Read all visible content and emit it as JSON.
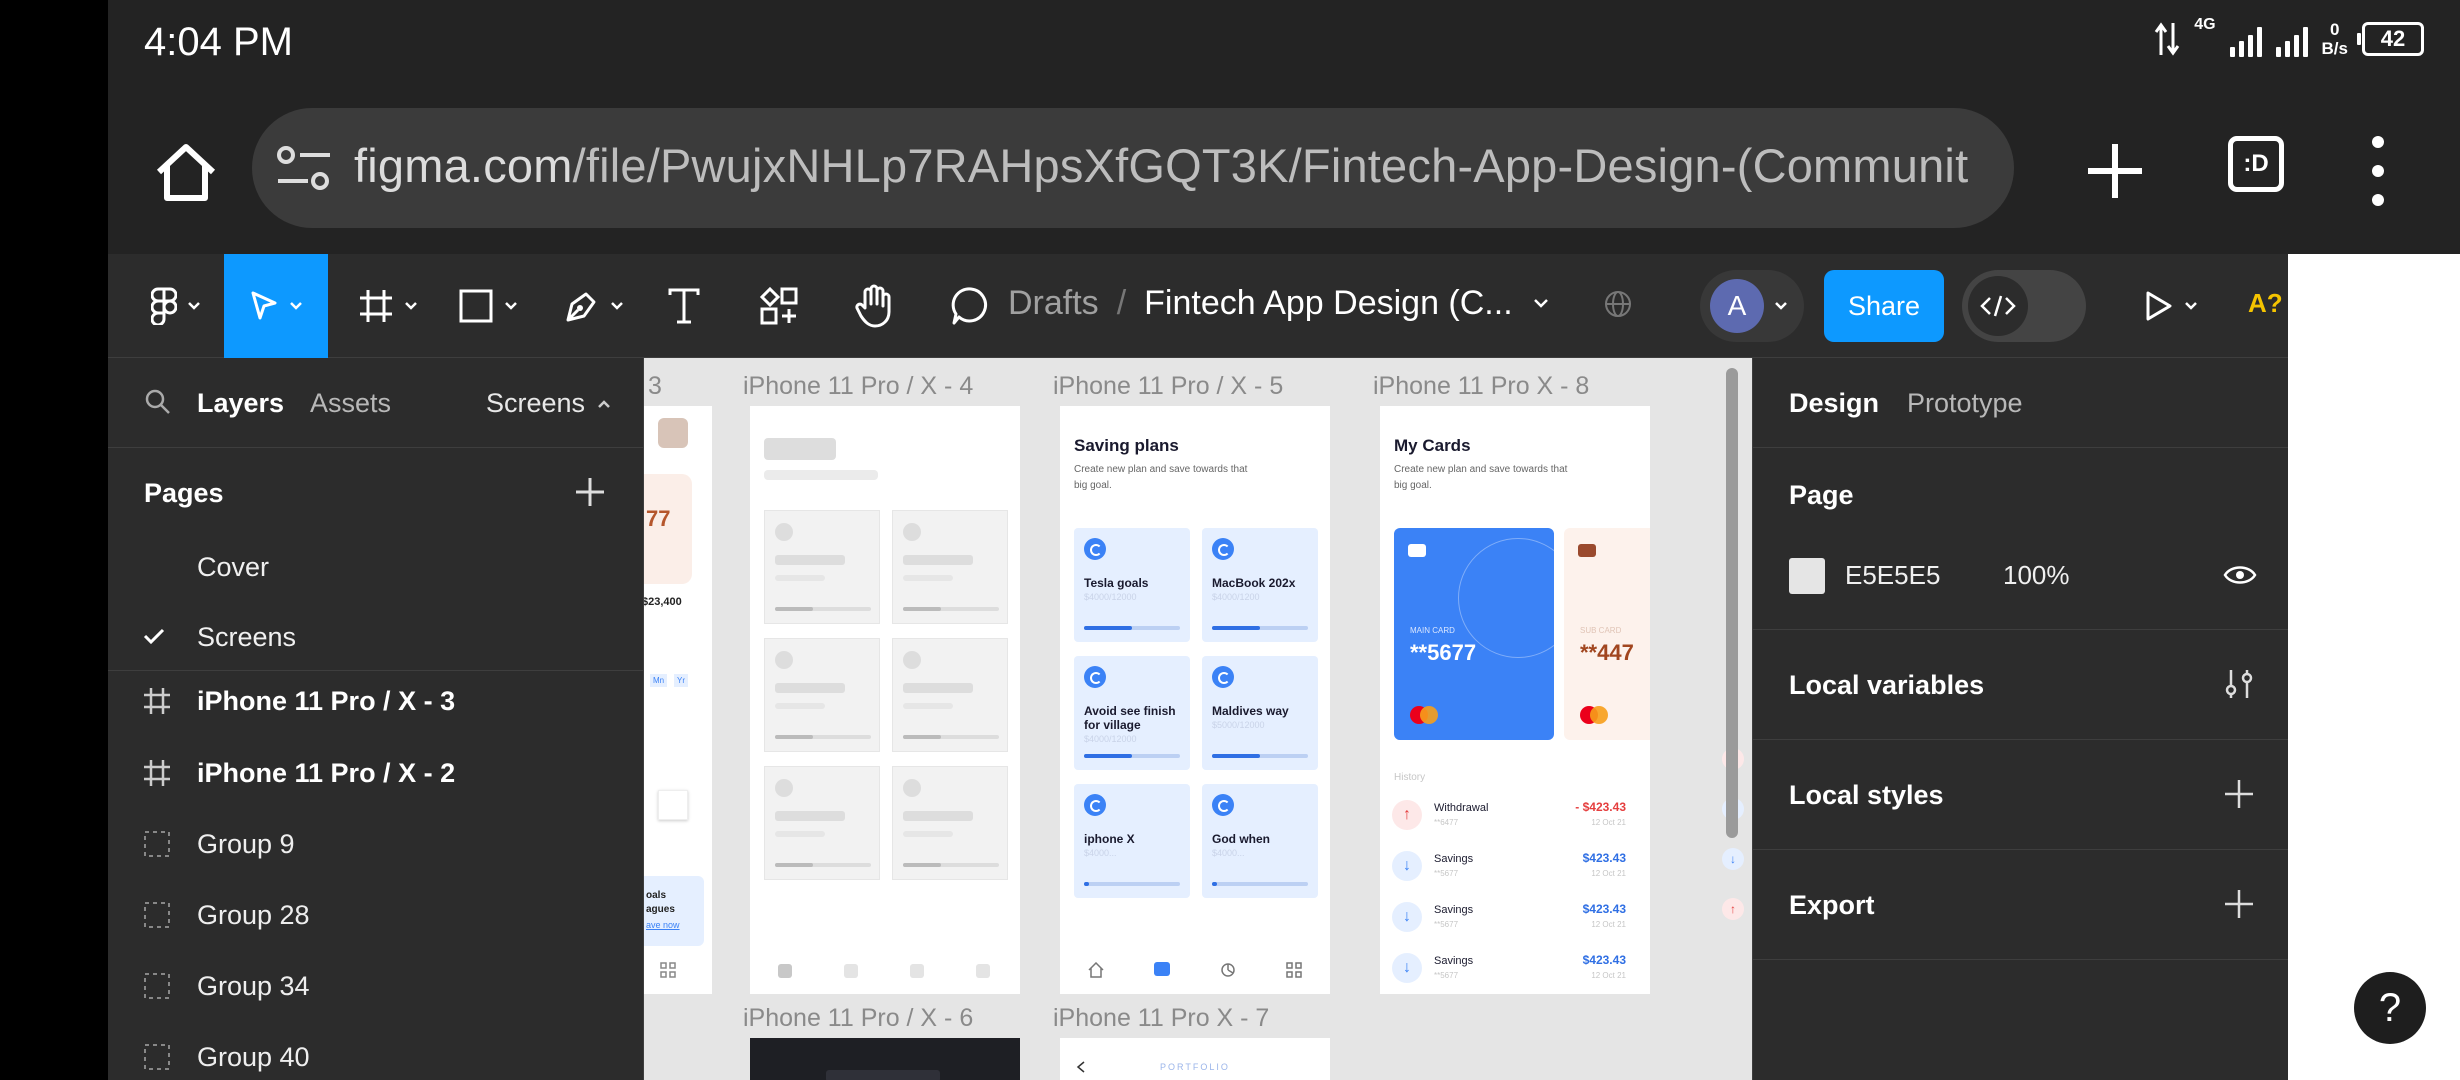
{
  "status_bar": {
    "time": "4:04 PM",
    "network_type": "4G",
    "data_speed_value": "0",
    "data_speed_unit": "B/s",
    "battery": "42"
  },
  "browser": {
    "url_host": "figma.com",
    "url_path": "/file/PwujxNHLp7RAHpsXfGQT3K/Fintech-App-Design-(Communit",
    "tabs_label": ":D"
  },
  "toolbar": {
    "breadcrumb_drafts": "Drafts",
    "breadcrumb_sep": "/",
    "file_name": "Fintech App Design (C...",
    "avatar_initial": "A",
    "share_label": "Share",
    "ai_label": "A?"
  },
  "left_panel": {
    "tabs": {
      "layers": "Layers",
      "assets": "Assets"
    },
    "current_page": "Screens",
    "pages_title": "Pages",
    "pages": [
      "Cover",
      "Screens"
    ],
    "layers": [
      {
        "label": "iPhone 11 Pro / X - 3",
        "type": "frame"
      },
      {
        "label": "iPhone 11 Pro / X - 2",
        "type": "frame"
      },
      {
        "label": "Group 9",
        "type": "group"
      },
      {
        "label": "Group 28",
        "type": "group"
      },
      {
        "label": "Group 34",
        "type": "group"
      },
      {
        "label": "Group 40",
        "type": "group"
      }
    ]
  },
  "canvas": {
    "background": "#E5E5E5",
    "frame_labels": {
      "x3": "3",
      "x4": "iPhone 11 Pro / X - 4",
      "x5": "iPhone 11 Pro / X - 5",
      "x8": "iPhone 11 Pro  X - 8",
      "x6": "iPhone 11 Pro / X - 6",
      "x7": "iPhone 11 Pro  X - 7"
    },
    "frame3": {
      "amount_partial": "77",
      "balance_partial": "$23,400",
      "chips": [
        "Mn",
        "Yr"
      ],
      "promo_l1": "oals",
      "promo_l2": "agues",
      "promo_link": "ave now"
    },
    "saving_plans": {
      "title": "Saving plans",
      "subtitle_l1": "Create new plan and save towards that",
      "subtitle_l2": "big goal.",
      "plans": [
        {
          "title": "Tesla goals",
          "sub": "$4000/12000",
          "progress": 0.5
        },
        {
          "title": "MacBook 202x",
          "sub": "$4000/1200",
          "progress": 0.5
        },
        {
          "title": "Avoid see finish for village",
          "sub": "$4000/12000",
          "progress": 0.5
        },
        {
          "title": "Maldives way",
          "sub": "$5000/12000",
          "progress": 0.5
        },
        {
          "title": "iphone X",
          "sub": "$4000...",
          "progress": 0.05
        },
        {
          "title": "God when",
          "sub": "$4000...",
          "progress": 0.05
        }
      ]
    },
    "my_cards": {
      "title": "My Cards",
      "subtitle_l1": "Create new plan and save towards that",
      "subtitle_l2": "big goal.",
      "card1_label": "MAIN CARD",
      "card1_number": "**5677",
      "card2_label": "SUB CARD",
      "card2_number": "**447",
      "history_label": "History",
      "transactions": [
        {
          "title": "Withdrawal",
          "sub": "**6477",
          "amount": "- $423.43",
          "date": "12 Oct 21",
          "direction": "up"
        },
        {
          "title": "Savings",
          "sub": "**5677",
          "amount": "$423.43",
          "date": "12 Oct 21",
          "direction": "down"
        },
        {
          "title": "Savings",
          "sub": "**5677",
          "amount": "$423.43",
          "date": "12 Oct 21",
          "direction": "down"
        },
        {
          "title": "Savings",
          "sub": "**5677",
          "amount": "$423.43",
          "date": "12 Oct 21",
          "direction": "down"
        }
      ]
    },
    "frame7_heading": "PORTFOLIO"
  },
  "right_panel": {
    "tabs": {
      "design": "Design",
      "prototype": "Prototype"
    },
    "page_heading": "Page",
    "page_color_hex": "E5E5E5",
    "page_color_opacity": "100%",
    "local_variables": "Local variables",
    "local_styles": "Local styles",
    "export": "Export"
  },
  "help_label": "?",
  "colors": {
    "accent": "#0D99FF",
    "toolbar_bg": "#2C2C2C",
    "card_blue": "#3B82F6",
    "negative": "#E53E3E"
  }
}
